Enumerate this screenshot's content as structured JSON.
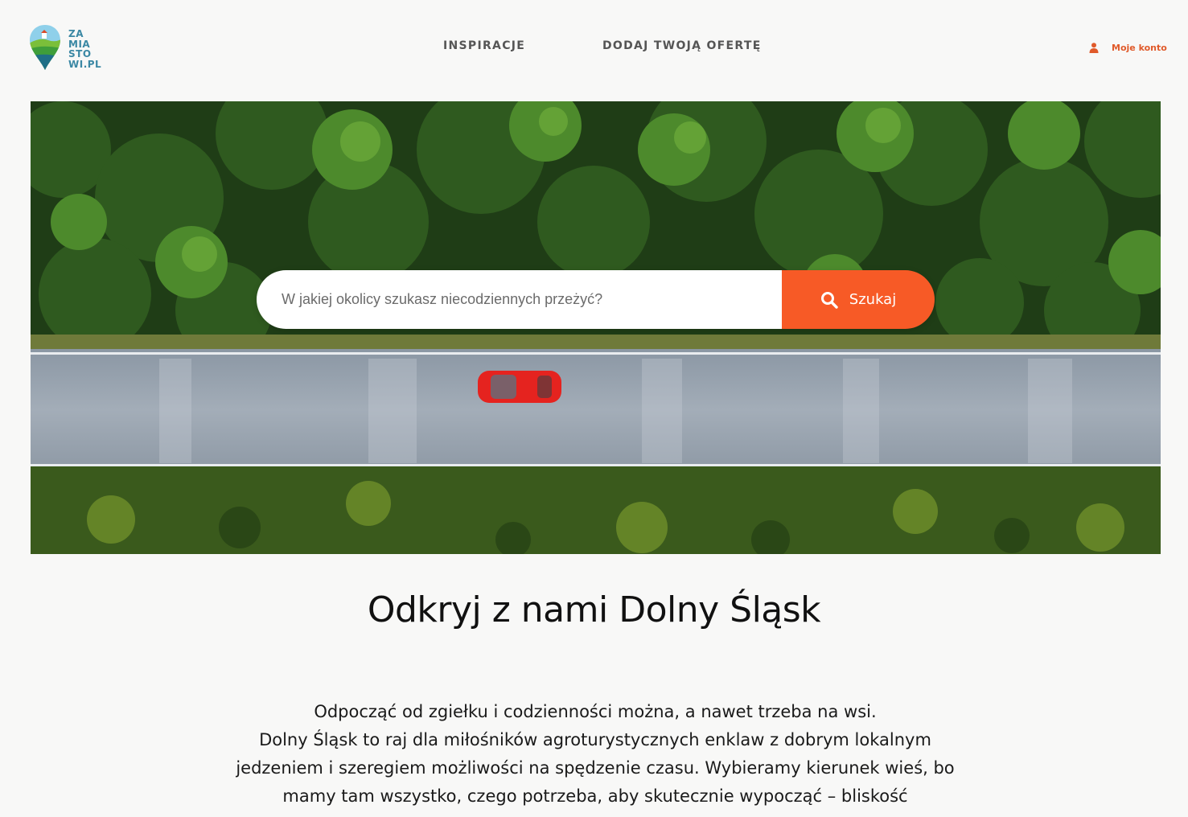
{
  "header": {
    "logo": {
      "lines": [
        "ZA",
        "MIA",
        "STO",
        "WI.PL"
      ],
      "icon": "map-pin-landscape-icon"
    },
    "nav": [
      {
        "label": "INSPIRACJE"
      },
      {
        "label": "DODAJ TWOJĄ OFERTĘ"
      }
    ],
    "account": {
      "label": "Moje konto",
      "icon": "user-icon"
    }
  },
  "hero": {
    "search": {
      "placeholder": "W jakiej okolicy szukasz niecodziennych przeżyć?",
      "value": "",
      "button_label": "Szukaj",
      "button_icon": "magnifier-icon"
    }
  },
  "main": {
    "title": "Odkryj z nami Dolny Śląsk",
    "intro": [
      "Odpocząć od zgiełku i codzienności można, a nawet trzeba na wsi.",
      "Dolny Śląsk to raj dla miłośników agroturystycznych enklaw z dobrym lokalnym jedzeniem i szeregiem możliwości na spędzenie czasu. Wybieramy kierunek wieś, bo mamy tam wszystko, czego potrzeba, aby skutecznie wypocząć – bliskość"
    ]
  },
  "colors": {
    "accent": "#f75a26",
    "account_text": "#e05a2a",
    "logo_text": "#3b88a4",
    "background": "#f8f8f7"
  }
}
